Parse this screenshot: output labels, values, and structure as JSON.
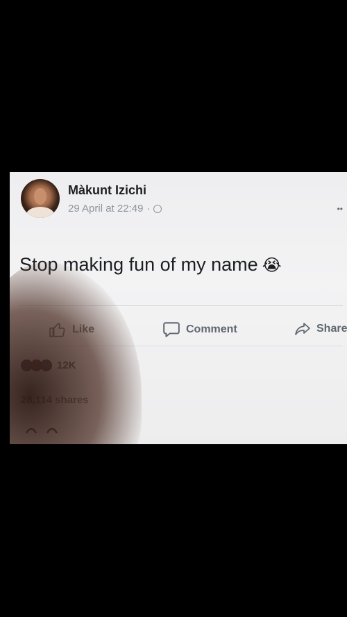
{
  "post": {
    "author": "Màkunt Izichi",
    "date": "29 April at 22:49",
    "separator": "·",
    "privacy_icon": "globe-icon",
    "text": "Stop making fun of my name",
    "emoji": "😭"
  },
  "actions": {
    "like_label": "Like",
    "comment_label": "Comment",
    "share_label": "Share"
  },
  "stats": {
    "reaction_icons": [
      "like-reaction-icon",
      "love-reaction-icon",
      "like-reaction-icon"
    ],
    "reaction_count": "12K",
    "shares": "28,114 shares"
  },
  "colors": {
    "text_primary": "#1c1e21",
    "text_secondary": "#8d949e",
    "action_gray": "#606770",
    "background": "#000000"
  }
}
